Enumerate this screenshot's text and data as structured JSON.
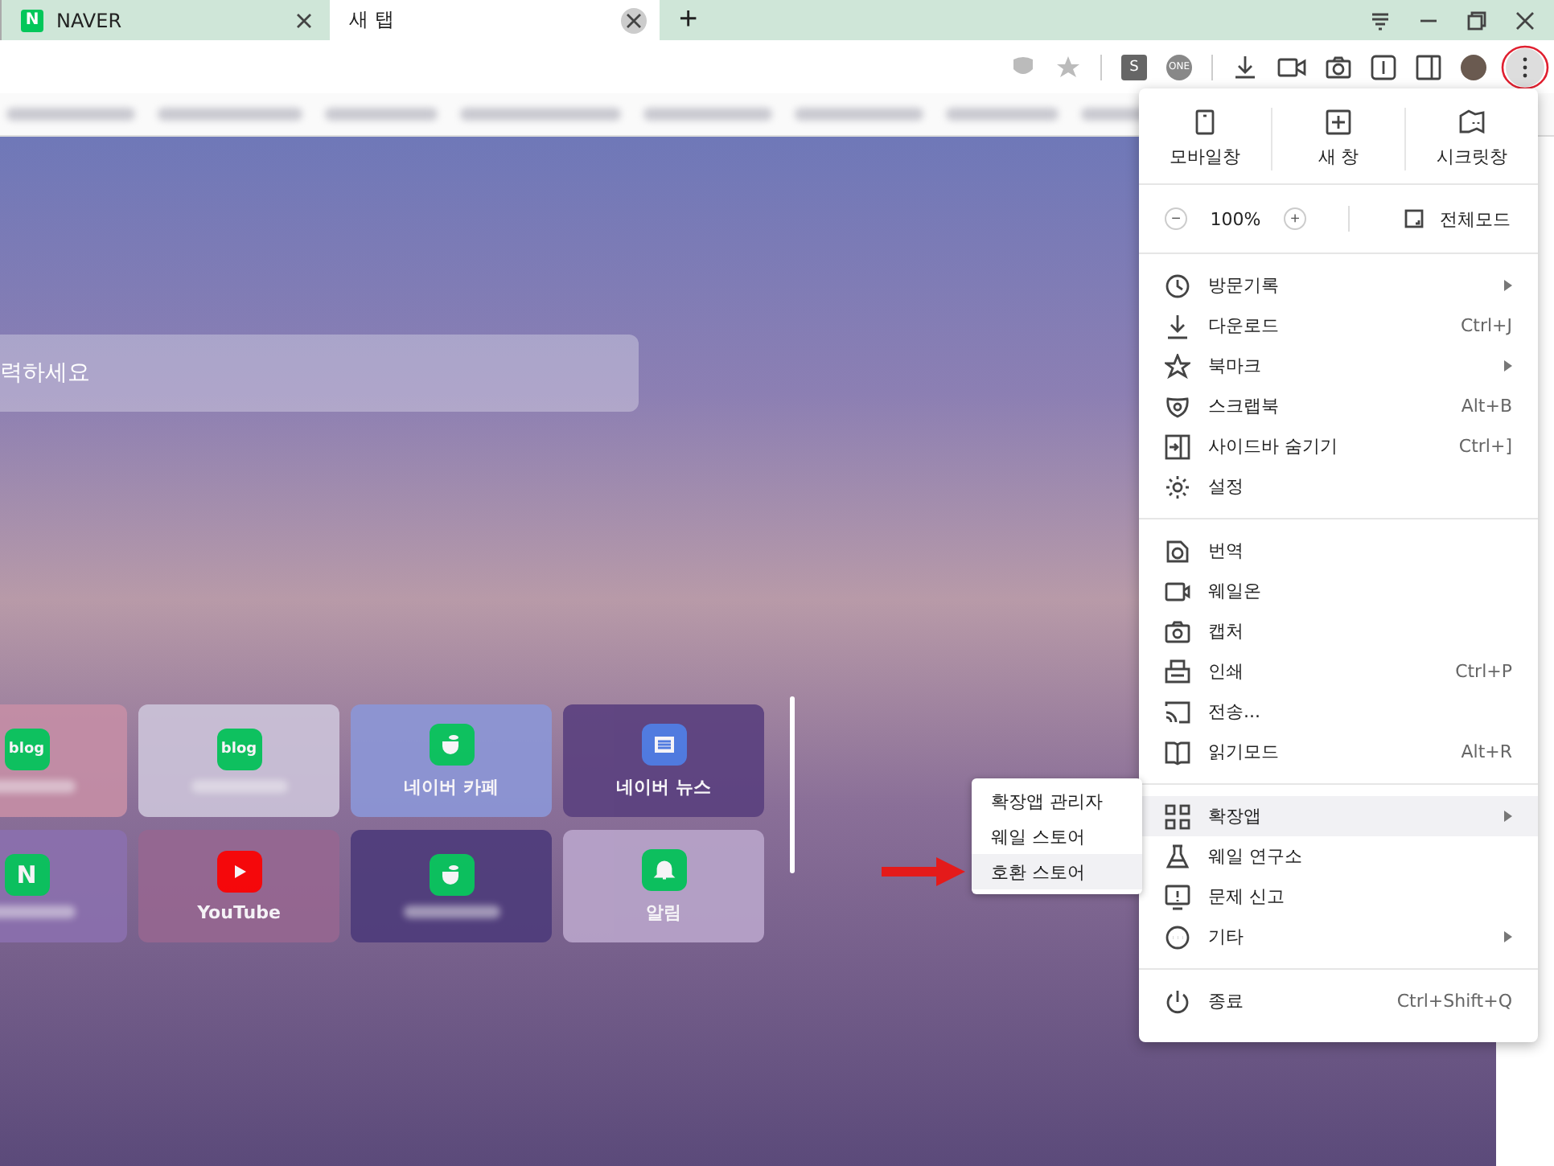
{
  "tabs": [
    {
      "label": "NAVER",
      "favicon": "N",
      "selected": false
    },
    {
      "label": "새 탭",
      "selected": true
    }
  ],
  "new_tab": "+",
  "toolbar": {
    "extensions": [
      "S",
      "ONE"
    ]
  },
  "search": {
    "placeholder": "력하세요"
  },
  "tiles": [
    {
      "kind": "blog",
      "icon_text": "blog",
      "color": "#c58ea6"
    },
    {
      "kind": "blog",
      "icon_text": "blog",
      "color": "#cbc2d8"
    },
    {
      "kind": "cafe",
      "label": "네이버 카페",
      "color": "#8c96d6"
    },
    {
      "kind": "news",
      "label": "네이버 뉴스",
      "color": "#5b417f"
    },
    {
      "kind": "naver",
      "icon_text": "N",
      "color": "#8b70ae"
    },
    {
      "kind": "youtube",
      "label": "YouTube",
      "color": "#966791"
    },
    {
      "kind": "cafe",
      "color": "#4e3c7b"
    },
    {
      "kind": "alarm",
      "label": "알림",
      "color": "#b8a4ca"
    }
  ],
  "menu": {
    "top_actions": [
      {
        "label": "모바일창"
      },
      {
        "label": "새 창"
      },
      {
        "label": "시크릿창"
      }
    ],
    "zoom": {
      "minus": "−",
      "value": "100%",
      "plus": "+"
    },
    "fullscreen": "전체모드",
    "sections": [
      [
        {
          "label": "방문기록",
          "submenu": true,
          "selected": false
        },
        {
          "label": "다운로드",
          "shortcut": "Ctrl+J",
          "submenu": false,
          "selected": false
        },
        {
          "label": "북마크",
          "submenu": true,
          "selected": false
        },
        {
          "label": "스크랩북",
          "shortcut": "Alt+B",
          "submenu": false,
          "selected": false
        },
        {
          "label": "사이드바 숨기기",
          "shortcut": "Ctrl+]",
          "submenu": false,
          "selected": false
        },
        {
          "label": "설정",
          "submenu": false,
          "selected": false
        }
      ],
      [
        {
          "label": "번역",
          "submenu": false,
          "selected": false
        },
        {
          "label": "웨일온",
          "submenu": false,
          "selected": false
        },
        {
          "label": "캡처",
          "submenu": false,
          "selected": false
        },
        {
          "label": "인쇄",
          "shortcut": "Ctrl+P",
          "submenu": false,
          "selected": false
        },
        {
          "label": "전송...",
          "submenu": false,
          "selected": false
        },
        {
          "label": "읽기모드",
          "shortcut": "Alt+R",
          "submenu": false,
          "selected": false
        }
      ],
      [
        {
          "label": "확장앱",
          "submenu": true,
          "selected": true
        },
        {
          "label": "웨일 연구소",
          "submenu": false,
          "selected": false
        },
        {
          "label": "문제 신고",
          "submenu": false,
          "selected": false
        },
        {
          "label": "기타",
          "submenu": true,
          "selected": false
        }
      ],
      [
        {
          "label": "종료",
          "shortcut": "Ctrl+Shift+Q",
          "submenu": false,
          "selected": false
        }
      ]
    ]
  },
  "submenu": [
    {
      "label": "확장앱 관리자",
      "selected": false
    },
    {
      "label": "웨일 스토어",
      "selected": false
    },
    {
      "label": "호환 스토어",
      "selected": true
    }
  ]
}
